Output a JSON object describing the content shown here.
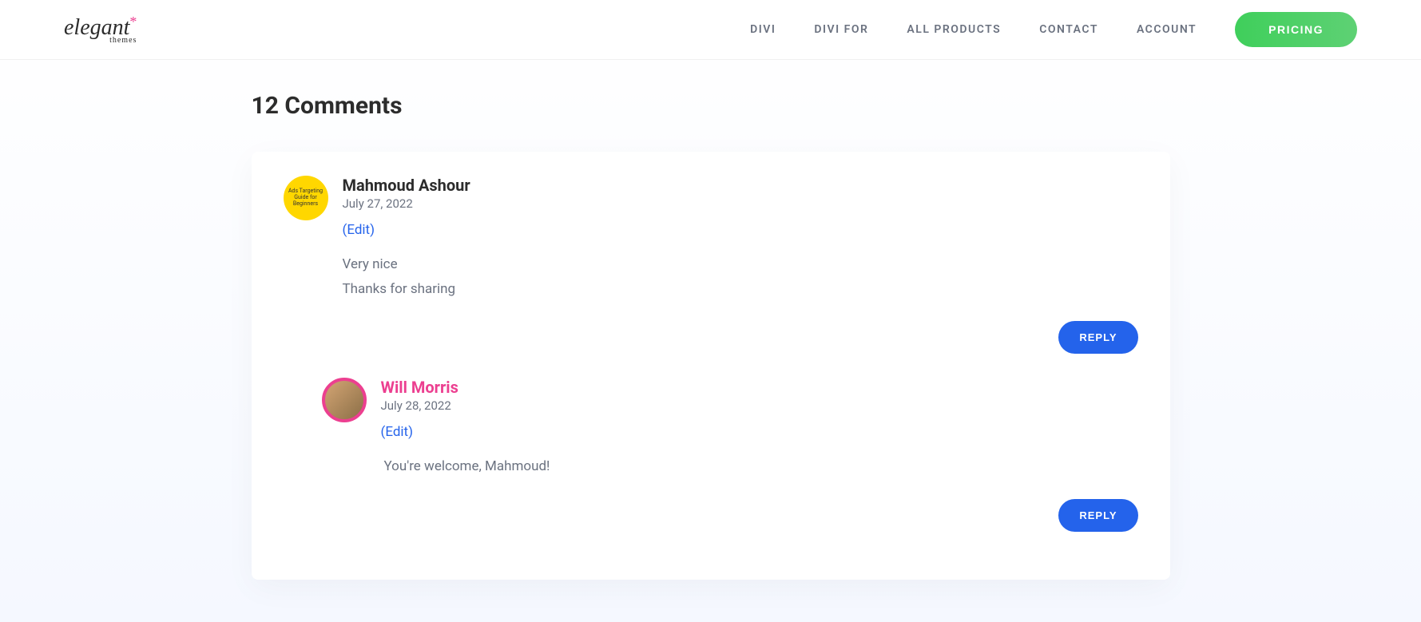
{
  "header": {
    "logo_main": "elegant",
    "logo_sub": "themes",
    "nav": {
      "divi": "DIVI",
      "divi_for": "DIVI FOR",
      "all_products": "ALL PRODUCTS",
      "contact": "CONTACT",
      "account": "ACCOUNT",
      "pricing": "PRICING"
    }
  },
  "comments": {
    "title": "12 Comments",
    "edit_label": "(Edit)",
    "reply_label": "REPLY",
    "items": [
      {
        "author": "Mahmoud Ashour",
        "date": "July 27, 2022",
        "body_line1": "Very nice",
        "body_line2": "Thanks for sharing",
        "avatar_text": "Ads Targeting Guide for Beginners"
      },
      {
        "author": "Will Morris",
        "date": "July 28, 2022",
        "body_line1": "You're welcome, Mahmoud!"
      }
    ]
  }
}
